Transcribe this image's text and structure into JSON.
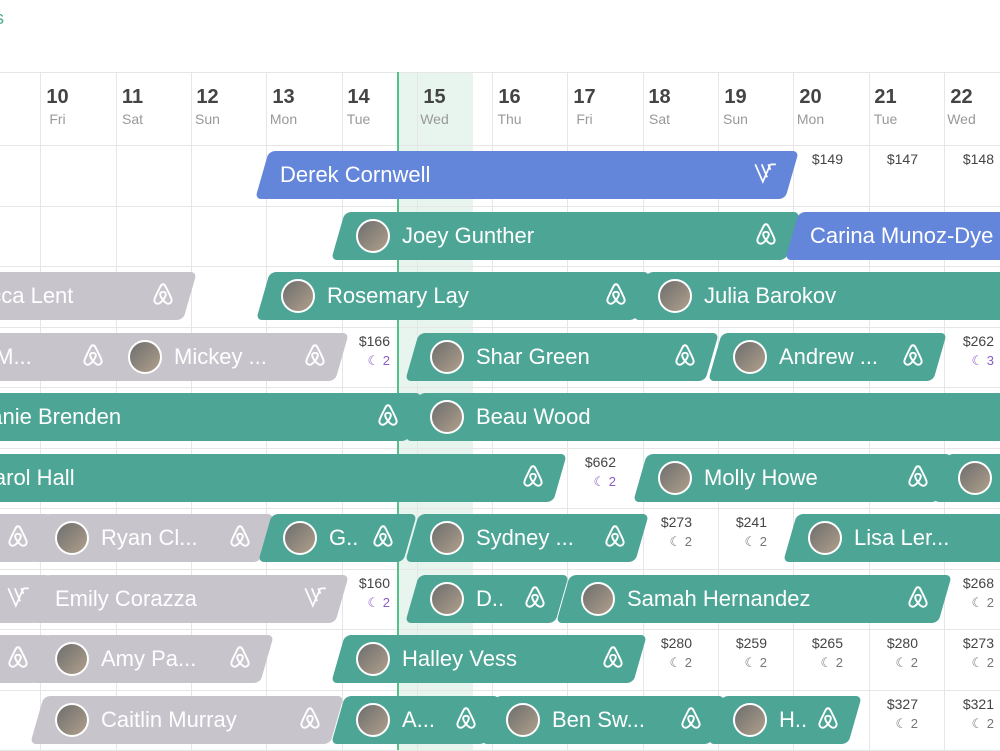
{
  "header": {
    "title": "rties"
  },
  "days": [
    {
      "num": "",
      "dow": ""
    },
    {
      "num": "10",
      "dow": "Fri"
    },
    {
      "num": "11",
      "dow": "Sat"
    },
    {
      "num": "12",
      "dow": "Sun"
    },
    {
      "num": "13",
      "dow": "Mon"
    },
    {
      "num": "14",
      "dow": "Tue"
    },
    {
      "num": "15",
      "dow": "Wed"
    },
    {
      "num": "16",
      "dow": "Thu"
    },
    {
      "num": "17",
      "dow": "Fri"
    },
    {
      "num": "18",
      "dow": "Sat"
    },
    {
      "num": "19",
      "dow": "Sun"
    },
    {
      "num": "20",
      "dow": "Mon"
    },
    {
      "num": "21",
      "dow": "Tue"
    },
    {
      "num": "22",
      "dow": "Wed"
    }
  ],
  "colors": {
    "teal": "#4da596",
    "grey": "#c7c4cc",
    "blue": "#6386db",
    "today": "#55c18a",
    "nights_purple": "#8a5cc7"
  },
  "bookings": [
    {
      "name": "Derek Cornwell",
      "color": "blue",
      "icon": "vrbo-icon",
      "avatar": false
    },
    {
      "name": "Joey Gunther",
      "color": "teal",
      "icon": "airbnb-icon",
      "avatar": true
    },
    {
      "name": "Carina Munoz-Dye",
      "color": "blue",
      "icon": "",
      "avatar": false
    },
    {
      "name": "ecca Lent",
      "color": "grey",
      "icon": "airbnb-icon",
      "avatar": false
    },
    {
      "name": "Rosemary Lay",
      "color": "teal",
      "icon": "airbnb-icon",
      "avatar": true
    },
    {
      "name": "Julia Barokov",
      "color": "teal",
      "icon": "",
      "avatar": true
    },
    {
      "name": "y M...",
      "color": "grey",
      "icon": "airbnb-icon",
      "avatar": false
    },
    {
      "name": "Mickey ...",
      "color": "grey",
      "icon": "airbnb-icon",
      "avatar": true
    },
    {
      "name": "Shar Green",
      "color": "teal",
      "icon": "airbnb-icon",
      "avatar": true
    },
    {
      "name": "Andrew ...",
      "color": "teal",
      "icon": "airbnb-icon",
      "avatar": true
    },
    {
      "name": "hanie Brenden",
      "color": "teal",
      "icon": "airbnb-icon",
      "avatar": false
    },
    {
      "name": "Beau Wood",
      "color": "teal",
      "icon": "",
      "avatar": true
    },
    {
      "name": "Carol Hall",
      "color": "teal",
      "icon": "airbnb-icon",
      "avatar": false
    },
    {
      "name": "Molly Howe",
      "color": "teal",
      "icon": "airbnb-icon",
      "avatar": true
    },
    {
      "name": "",
      "color": "teal",
      "icon": "",
      "avatar": true
    },
    {
      "name": "",
      "color": "grey",
      "icon": "airbnb-icon",
      "avatar": false
    },
    {
      "name": "Ryan Cl...",
      "color": "grey",
      "icon": "airbnb-icon",
      "avatar": true
    },
    {
      "name": "G..",
      "color": "teal",
      "icon": "airbnb-icon",
      "avatar": true
    },
    {
      "name": "Sydney ...",
      "color": "teal",
      "icon": "airbnb-icon",
      "avatar": true
    },
    {
      "name": "Lisa Ler...",
      "color": "teal",
      "icon": "airbnb-icon",
      "avatar": true
    },
    {
      "name": "",
      "color": "grey",
      "icon": "vrbo-icon",
      "avatar": false
    },
    {
      "name": "Emily Corazza",
      "color": "grey",
      "icon": "vrbo-icon",
      "avatar": false
    },
    {
      "name": "D..",
      "color": "teal",
      "icon": "airbnb-icon",
      "avatar": true
    },
    {
      "name": "Samah Hernandez",
      "color": "teal",
      "icon": "airbnb-icon",
      "avatar": true
    },
    {
      "name": "",
      "color": "grey",
      "icon": "airbnb-icon",
      "avatar": false
    },
    {
      "name": "Amy Pa...",
      "color": "grey",
      "icon": "airbnb-icon",
      "avatar": true
    },
    {
      "name": "Halley Vess",
      "color": "teal",
      "icon": "airbnb-icon",
      "avatar": true
    },
    {
      "name": "Caitlin Murray",
      "color": "grey",
      "icon": "airbnb-icon",
      "avatar": true
    },
    {
      "name": "A...",
      "color": "teal",
      "icon": "airbnb-icon",
      "avatar": true
    },
    {
      "name": "Ben Sw...",
      "color": "teal",
      "icon": "airbnb-icon",
      "avatar": true
    },
    {
      "name": "H..",
      "color": "teal",
      "icon": "airbnb-icon",
      "avatar": true
    }
  ],
  "rates": [
    {
      "price": "$149",
      "nights": ""
    },
    {
      "price": "$147",
      "nights": ""
    },
    {
      "price": "$148",
      "nights": ""
    },
    {
      "price": "$166",
      "nights": "2"
    },
    {
      "price": "$262",
      "nights": "3"
    },
    {
      "price": "$662",
      "nights": "2"
    },
    {
      "price": "$273",
      "nights": "2"
    },
    {
      "price": "$241",
      "nights": "2"
    },
    {
      "price": "$160",
      "nights": "2"
    },
    {
      "price": "$268",
      "nights": "2"
    },
    {
      "price": "$280",
      "nights": "2"
    },
    {
      "price": "$259",
      "nights": "2"
    },
    {
      "price": "$265",
      "nights": "2"
    },
    {
      "price": "$280",
      "nights": "2"
    },
    {
      "price": "$273",
      "nights": "2"
    },
    {
      "price": "$327",
      "nights": "2"
    },
    {
      "price": "$321",
      "nights": "2"
    }
  ]
}
